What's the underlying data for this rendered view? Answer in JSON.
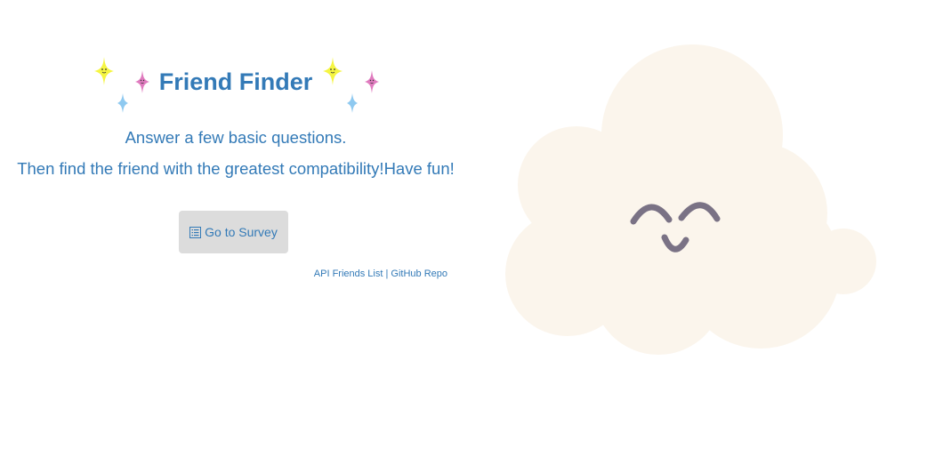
{
  "app": {
    "title": "Friend Finder",
    "tagline_1": "Answer a few basic questions.",
    "tagline_2": "Then find the friend with the greatest compatibility!Have fun!"
  },
  "actions": {
    "survey_label": "Go to Survey",
    "survey_icon": "list-alt-icon"
  },
  "footer": {
    "api_link": "API Friends List",
    "separator": "|",
    "github_link": "GitHub Repo"
  },
  "decor": {
    "sparkle_colors": [
      "#f5f542",
      "#e07bbf",
      "#8ec9f0"
    ],
    "cloud_color": "#fbf5ec",
    "face_color": "#7a7285",
    "accent": "#337ab7"
  }
}
